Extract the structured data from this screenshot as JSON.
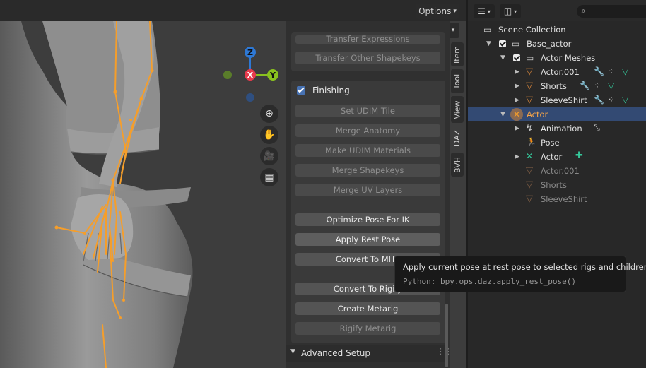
{
  "viewport": {
    "options_label": "Options",
    "nav_tools": [
      "zoom",
      "pan",
      "camera",
      "grid"
    ],
    "gizmo": {
      "z": "Z",
      "x": "X",
      "y": "Y"
    }
  },
  "tabs": [
    "Item",
    "Tool",
    "View",
    "DAZ",
    "BVH"
  ],
  "daz_panel": {
    "partial_top_1": "Transfer Expressions",
    "partial_top_2": "Transfer Other Shapekeys",
    "section_label": "Finishing",
    "buttons": [
      {
        "label": "Set UDIM Tile",
        "enabled": false
      },
      {
        "label": "Merge Anatomy",
        "enabled": false
      },
      {
        "label": "Make UDIM Materials",
        "enabled": false
      },
      {
        "label": "Merge Shapekeys",
        "enabled": false
      },
      {
        "label": "Merge UV Layers",
        "enabled": false
      },
      {
        "label": "Optimize Pose For IK",
        "enabled": true
      },
      {
        "label": "Apply Rest Pose",
        "enabled": true
      },
      {
        "label": "Convert To MHX",
        "enabled": true
      },
      {
        "label": "Convert To Rigify",
        "enabled": true
      },
      {
        "label": "Create Metarig",
        "enabled": true
      },
      {
        "label": "Rigify Metarig",
        "enabled": false
      }
    ],
    "advanced_label": "Advanced Setup"
  },
  "tooltip": {
    "text": "Apply current pose at rest pose to selected rigs and children.",
    "python": "Python: bpy.ops.daz.apply_rest_pose()"
  },
  "outliner": {
    "search_placeholder": "",
    "rows": [
      {
        "label": "Scene Collection"
      },
      {
        "label": "Base_actor"
      },
      {
        "label": "Actor Meshes"
      },
      {
        "label": "Actor.001"
      },
      {
        "label": "Shorts"
      },
      {
        "label": "SleeveShirt"
      },
      {
        "label": "Actor"
      },
      {
        "label": "Animation"
      },
      {
        "label": "Pose"
      },
      {
        "label": "Actor"
      },
      {
        "label": "Actor.001"
      },
      {
        "label": "Shorts"
      },
      {
        "label": "SleeveShirt"
      }
    ]
  },
  "colors": {
    "accent_blue": "#4772b3",
    "bone_orange": "#f59e2b",
    "mesh_orange": "#e08a3c",
    "selected_row": "#334a73"
  }
}
